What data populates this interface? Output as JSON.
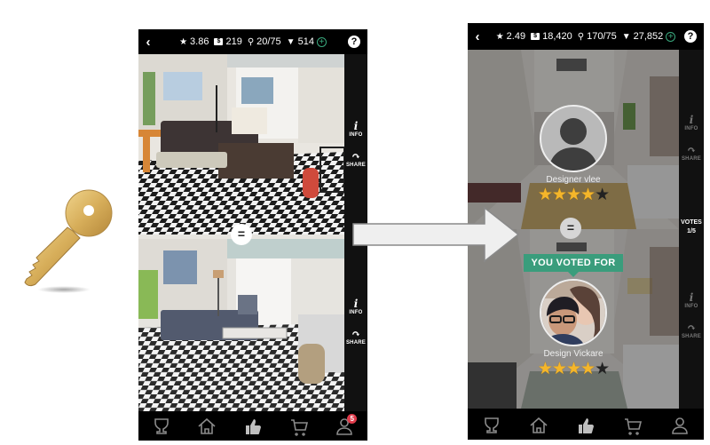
{
  "left_phone": {
    "topbar": {
      "back_icon": "chevron-left",
      "rating": "3.86",
      "cash": "219",
      "keys": "20/75",
      "diamonds": "514",
      "help_label": "?"
    },
    "side_top": {
      "info_label": "INFO",
      "share_label": "SHARE"
    },
    "side_bottom": {
      "info_label": "INFO",
      "share_label": "SHARE"
    },
    "compare_label": "=",
    "nav": {
      "items": [
        "trophy",
        "home",
        "thumbs-up",
        "cart",
        "profile"
      ],
      "active": "thumbs-up",
      "profile_badge": "5"
    }
  },
  "right_phone": {
    "topbar": {
      "back_icon": "chevron-left",
      "rating": "2.49",
      "cash": "18,420",
      "keys": "170/75",
      "diamonds": "27,852",
      "help_label": "?"
    },
    "side_top": {
      "info_label": "INFO",
      "share_label": "SHARE"
    },
    "side_bottom": {
      "info_label": "INFO",
      "share_label": "SHARE"
    },
    "votes_label": "VOTES",
    "votes_value": "1/5",
    "compare_label": "=",
    "designer_top": {
      "name": "Designer vlee",
      "rating": 4,
      "max_rating": 5,
      "avatar": "placeholder-silhouette"
    },
    "designer_bottom": {
      "name": "Design Vickare",
      "rating": 4,
      "max_rating": 5,
      "avatar": "photo",
      "voted_label": "YOU VOTED FOR"
    },
    "nav": {
      "items": [
        "trophy",
        "home",
        "thumbs-up",
        "cart",
        "profile"
      ],
      "active": "thumbs-up"
    }
  },
  "colors": {
    "voted_badge": "#3a9d7c",
    "star": "#f5b62a",
    "notification_badge": "#e03c4c",
    "plus_green": "#3aa97e"
  }
}
